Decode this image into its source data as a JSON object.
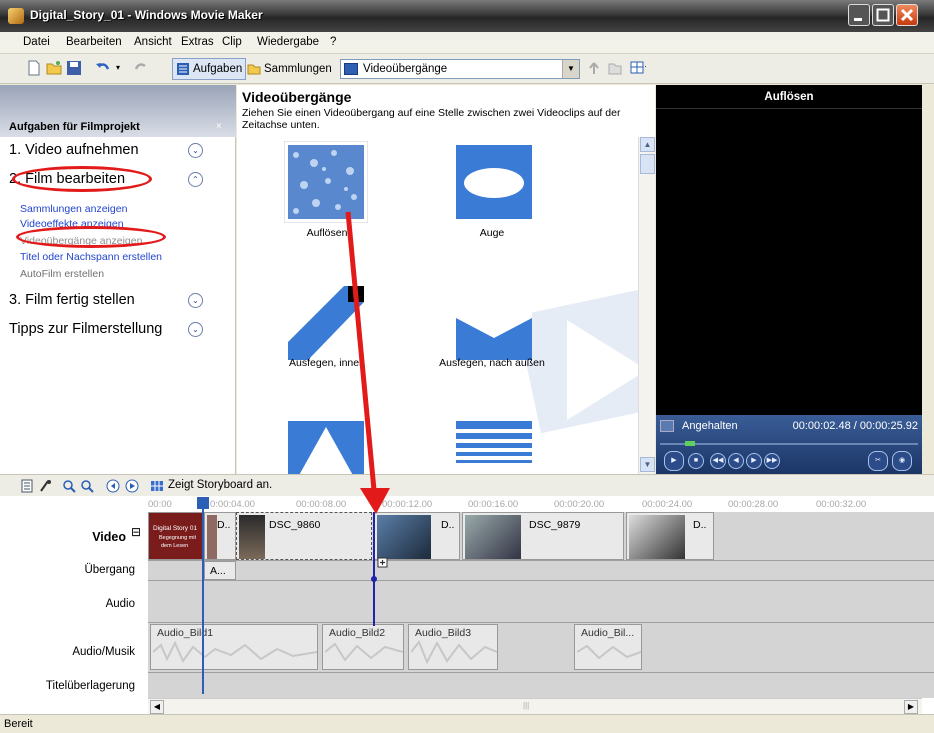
{
  "window": {
    "title": "Digital_Story_01 - Windows Movie Maker",
    "colors": {
      "titlebar": "#3a3a3a",
      "close": "#c8390e"
    }
  },
  "menu": [
    "Datei",
    "Bearbeiten",
    "Ansicht",
    "Extras",
    "Clip",
    "Wiedergabe",
    "?"
  ],
  "toolbar": {
    "tasks_label": "Aufgaben",
    "collections_label": "Sammlungen",
    "combo_value": "Videoübergänge"
  },
  "taskpane": {
    "title": "Aufgaben für Filmprojekt",
    "close": "×",
    "sections": [
      {
        "label": "1. Video aufnehmen",
        "toggle": "⌄"
      },
      {
        "label": "2. Film bearbeiten",
        "toggle": "⌃"
      },
      {
        "label": "3. Film fertig stellen",
        "toggle": "⌄"
      },
      {
        "label": "Tipps zur Filmerstellung",
        "toggle": "⌄"
      }
    ],
    "links": [
      "Sammlungen anzeigen",
      "Videoeffekte anzeigen",
      "Videoübergänge anzeigen",
      "Titel oder Nachspann erstellen",
      "AutoFilm erstellen"
    ],
    "highlight_color": "#e31a1a"
  },
  "content": {
    "title": "Videoübergänge",
    "description": "Ziehen Sie einen Videoübergang auf eine Stelle zwischen zwei Videoclips auf der Zeitachse unten.",
    "transitions": [
      "Auflösen",
      "Auge",
      "Ausfegen, innen",
      "Ausfegen, nach außen"
    ]
  },
  "preview": {
    "title": "Auflösen",
    "status": "Angehalten",
    "time": "00:00:02.48 / 00:00:25.92",
    "progress": 0.096
  },
  "timeline": {
    "toolbar_text": "Zeigt Storyboard an.",
    "ruler": [
      "00:00",
      "0:00:04.00",
      "00:00:08.00",
      "00:00:12.00",
      "00:00:16.00",
      "00:00:20.00",
      "00:00:24.00",
      "00:00:28.00",
      "00:00:32.00"
    ],
    "tracks": [
      "Video",
      "Übergang",
      "Audio",
      "Audio/Musik",
      "Titelüberlagerung"
    ],
    "video_collapse": "⊟",
    "title_clip": [
      "Digital Story 01",
      "Begegnung mit",
      "dem Lesen"
    ],
    "video_clips": [
      "D..",
      "DSC_9860",
      "D..",
      "DSC_9879",
      "D.."
    ],
    "transition_clip": "A...",
    "audio_clips": [
      "Audio_Bild1",
      "Audio_Bild2",
      "Audio_Bild3",
      "Audio_Bil..."
    ]
  },
  "status": "Bereit"
}
